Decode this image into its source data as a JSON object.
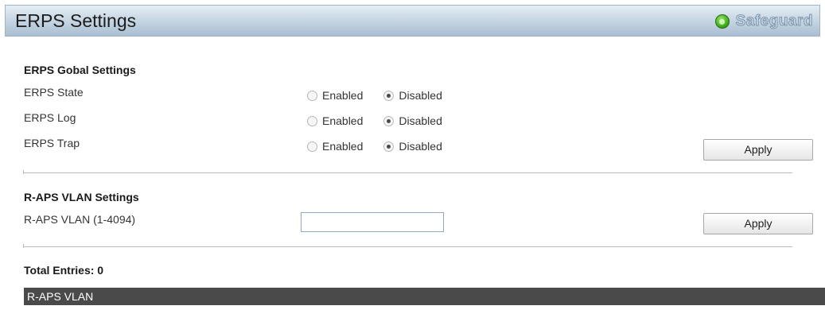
{
  "header": {
    "title": "ERPS Settings",
    "safeguard_label": "Safeguard"
  },
  "global_settings": {
    "section_title": "ERPS Gobal Settings",
    "rows": [
      {
        "label": "ERPS State",
        "enabled_label": "Enabled",
        "disabled_label": "Disabled",
        "selected": "Disabled"
      },
      {
        "label": "ERPS Log",
        "enabled_label": "Enabled",
        "disabled_label": "Disabled",
        "selected": "Disabled"
      },
      {
        "label": "ERPS Trap",
        "enabled_label": "Enabled",
        "disabled_label": "Disabled",
        "selected": "Disabled"
      }
    ],
    "apply_label": "Apply"
  },
  "raps_settings": {
    "section_title": "R-APS VLAN Settings",
    "field_label": "R-APS VLAN (1-4094)",
    "field_value": "",
    "apply_label": "Apply"
  },
  "table": {
    "total_entries": "Total Entries: 0",
    "columns": [
      "R-APS VLAN"
    ]
  },
  "colors": {
    "accent_green": "#3fae1a",
    "table_header_bg": "#4a4a4a"
  }
}
